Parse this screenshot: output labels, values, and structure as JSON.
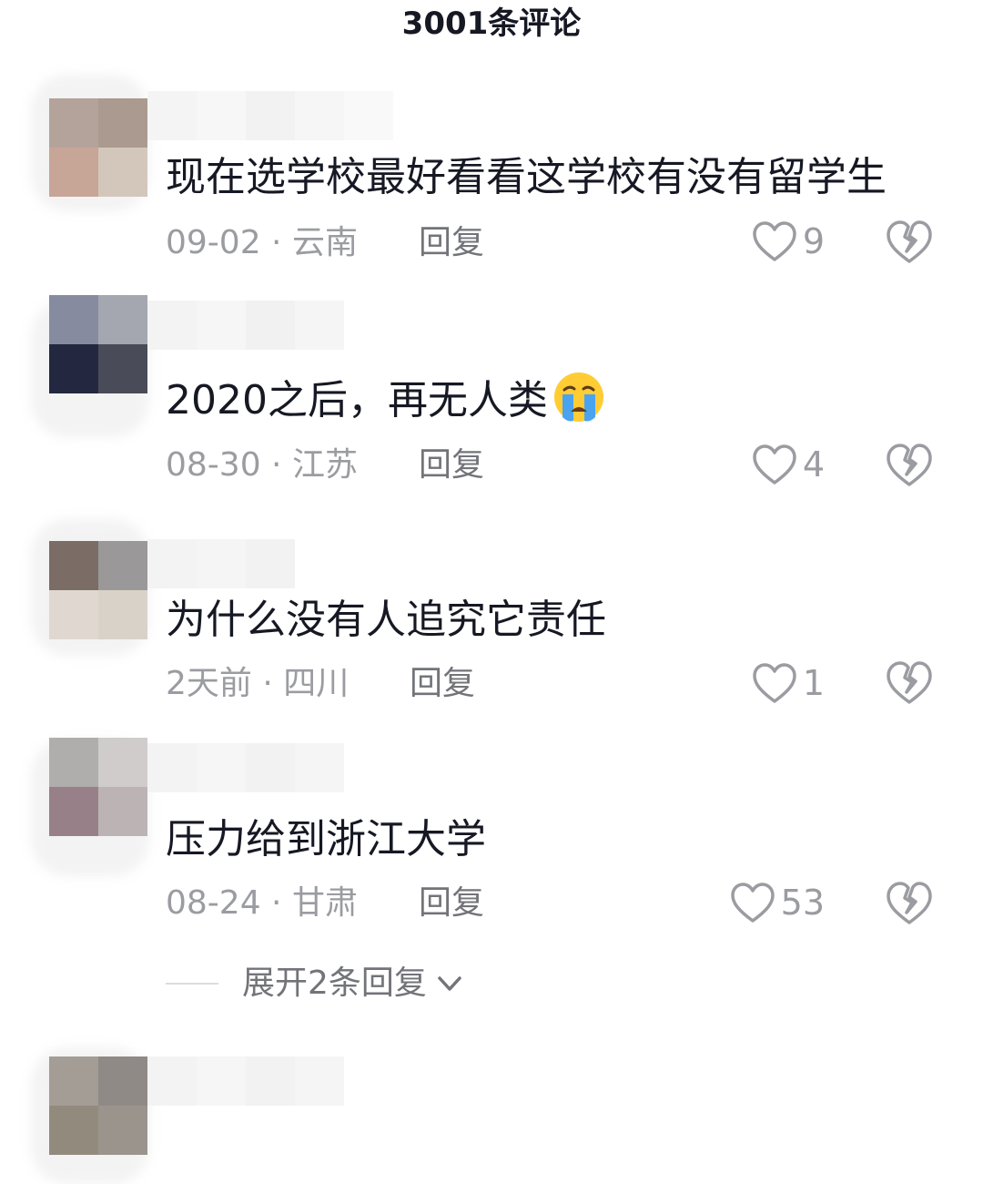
{
  "header": {
    "title": "3001条评论"
  },
  "comments": [
    {
      "text": "现在选学校最好看看这学校有没有留学生",
      "date_region": "09-02 · 云南",
      "reply_label": "回复",
      "likes": "9"
    },
    {
      "text": "2020之后，再无人类",
      "emoji": "crying-face-icon",
      "date_region": "08-30 · 江苏",
      "reply_label": "回复",
      "likes": "4"
    },
    {
      "text": "为什么没有人追究它责任",
      "date_region": "2天前 · 四川",
      "reply_label": "回复",
      "likes": "1"
    },
    {
      "text": "压力给到浙江大学",
      "date_region": "08-24 · 甘肃",
      "reply_label": "回复",
      "likes": "53"
    }
  ],
  "expand_replies": {
    "label": "展开2条回复"
  },
  "colors": {
    "text_primary": "#161823",
    "text_secondary": "#9b9ca1",
    "reply": "#73747a",
    "background": "#ffffff"
  }
}
